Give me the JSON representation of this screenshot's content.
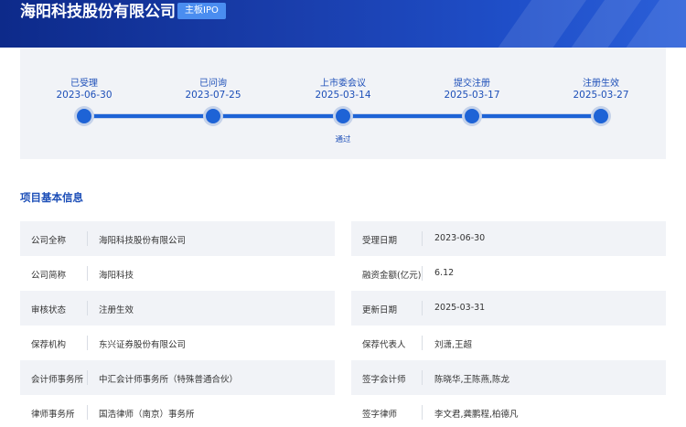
{
  "header": {
    "company_title": "海阳科技股份有限公司",
    "board_tag": "主板IPO"
  },
  "timeline": {
    "steps": [
      {
        "label": "已受理",
        "date": "2023-06-30",
        "note": ""
      },
      {
        "label": "已问询",
        "date": "2023-07-25",
        "note": ""
      },
      {
        "label": "上市委会议",
        "date": "2025-03-14",
        "note": "通过"
      },
      {
        "label": "提交注册",
        "date": "2025-03-17",
        "note": ""
      },
      {
        "label": "注册生效",
        "date": "2025-03-27",
        "note": ""
      }
    ]
  },
  "section": {
    "title": "项目基本信息"
  },
  "info": {
    "rows": [
      {
        "left_label": "公司全称",
        "left_value": "海阳科技股份有限公司",
        "right_label": "受理日期",
        "right_value": "2023-06-30"
      },
      {
        "left_label": "公司简称",
        "left_value": "海阳科技",
        "right_label": "融资金额(亿元)",
        "right_value": "6.12"
      },
      {
        "left_label": "审核状态",
        "left_value": "注册生效",
        "right_label": "更新日期",
        "right_value": "2025-03-31"
      },
      {
        "left_label": "保荐机构",
        "left_value": "东兴证券股份有限公司",
        "right_label": "保荐代表人",
        "right_value": "刘潇,王超"
      },
      {
        "left_label": "会计师事务所",
        "left_value": "中汇会计师事务所（特殊普通合伙）",
        "right_label": "签字会计师",
        "right_value": "陈晓华,王陈燕,陈龙"
      },
      {
        "left_label": "律师事务所",
        "left_value": "国浩律师（南京）事务所",
        "right_label": "签字律师",
        "right_value": "李文君,龚鹏程,柏德凡"
      }
    ]
  }
}
